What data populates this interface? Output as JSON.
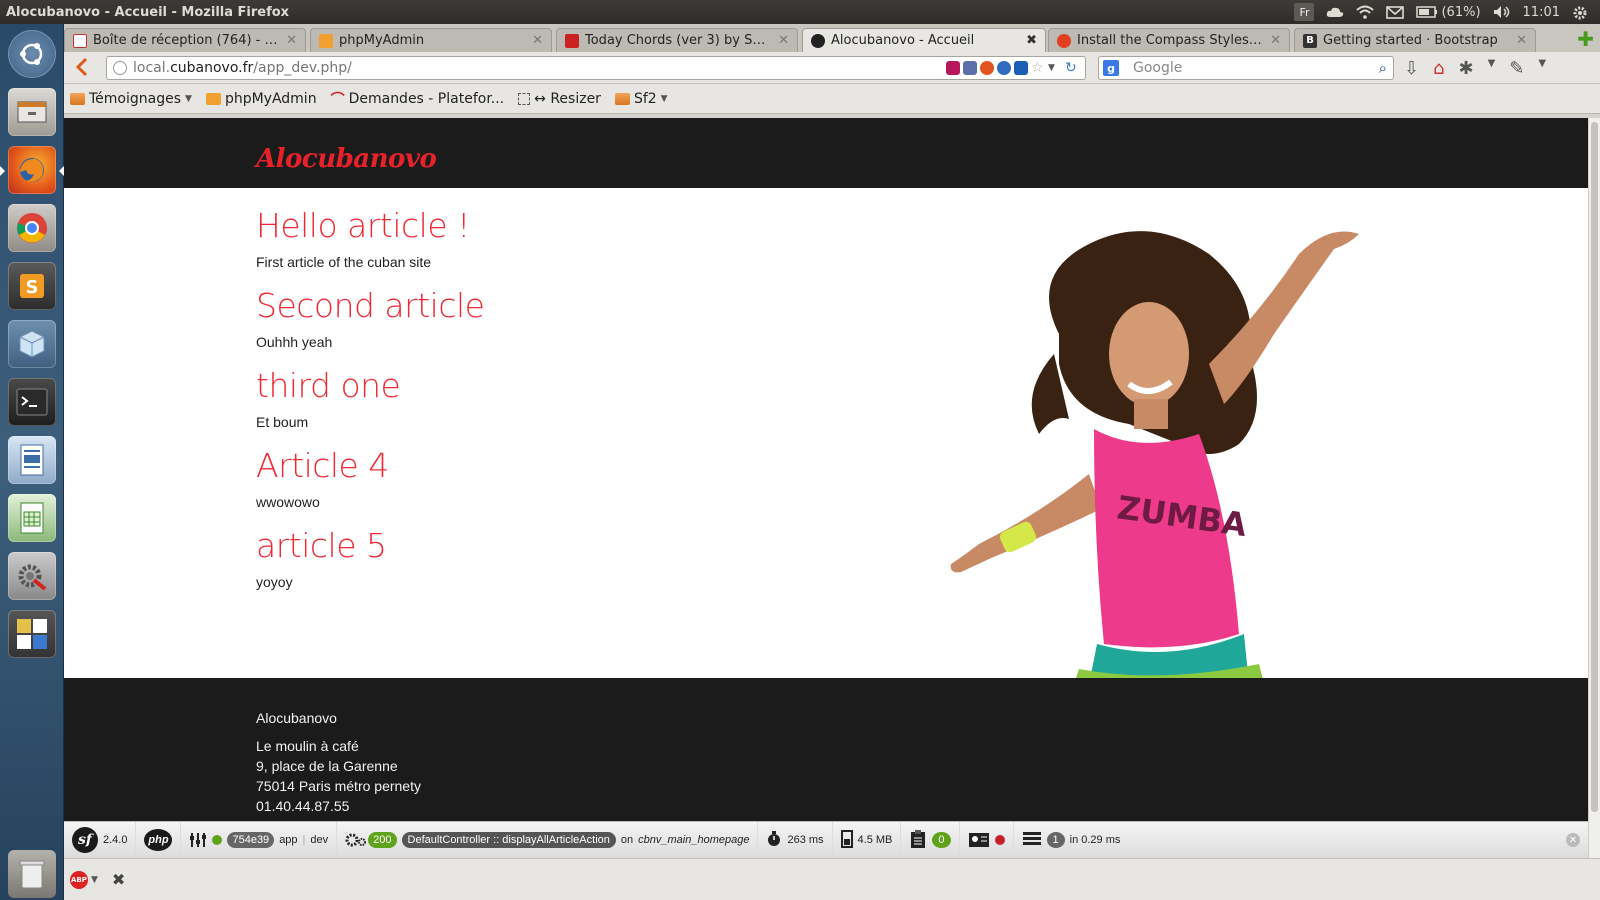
{
  "panel": {
    "window_title": "Alocubanovo - Accueil - Mozilla Firefox",
    "keyboard": "Fr",
    "battery": "(61%)",
    "clock": "11:01"
  },
  "tabs": [
    {
      "label": "Boîte de réception (764) - m...",
      "color": "#c33"
    },
    {
      "label": "phpMyAdmin",
      "color": "#f0a030"
    },
    {
      "label": "Today Chords (ver 3) by Sm...",
      "color": "#c22"
    },
    {
      "label": "Alocubanovo - Accueil",
      "color": "#222"
    },
    {
      "label": "Install the Compass Stylesh...",
      "color": "#e04020"
    },
    {
      "label": "Getting started · Bootstrap",
      "color": "#333"
    }
  ],
  "url": {
    "prefix": "local.",
    "host": "cubanovo.fr",
    "path": "/app_dev.php/"
  },
  "search": {
    "placeholder": "Google"
  },
  "bookmarks": [
    {
      "label": "Témoignages"
    },
    {
      "label": "phpMyAdmin"
    },
    {
      "label": "Demandes - Platefor..."
    },
    {
      "label": "↔ Resizer"
    },
    {
      "label": "Sf2"
    }
  ],
  "site": {
    "brand": "Alocubanovo",
    "articles": [
      {
        "title": "Hello article !",
        "body": "First article of the cuban site"
      },
      {
        "title": "Second article",
        "body": "Ouhhh yeah"
      },
      {
        "title": "third one",
        "body": "Et boum"
      },
      {
        "title": "Article 4",
        "body": "wwowowo"
      },
      {
        "title": "article 5",
        "body": "yoyoy"
      }
    ],
    "shirt_text": "ZUMBA",
    "footer": {
      "name": "Alocubanovo",
      "line1": "Le moulin à café",
      "line2": "9, place de la Garenne",
      "line3": "75014 Paris métro pernety",
      "phone": "01.40.44.87.55"
    }
  },
  "symfony": {
    "version": "2.4.0",
    "token": "754e39",
    "app": "app",
    "env": "dev",
    "status": "200",
    "controller": "DefaultController :: displayAllArticleAction",
    "route_prefix": "on",
    "route": "cbnv_main_homepage",
    "time": "263 ms",
    "memory": "4.5 MB",
    "logs": "0",
    "queries": "1",
    "query_time": "in 0.29 ms"
  },
  "colors": {
    "accent": "#ee2a35",
    "header_bg": "#1b1b1b"
  }
}
